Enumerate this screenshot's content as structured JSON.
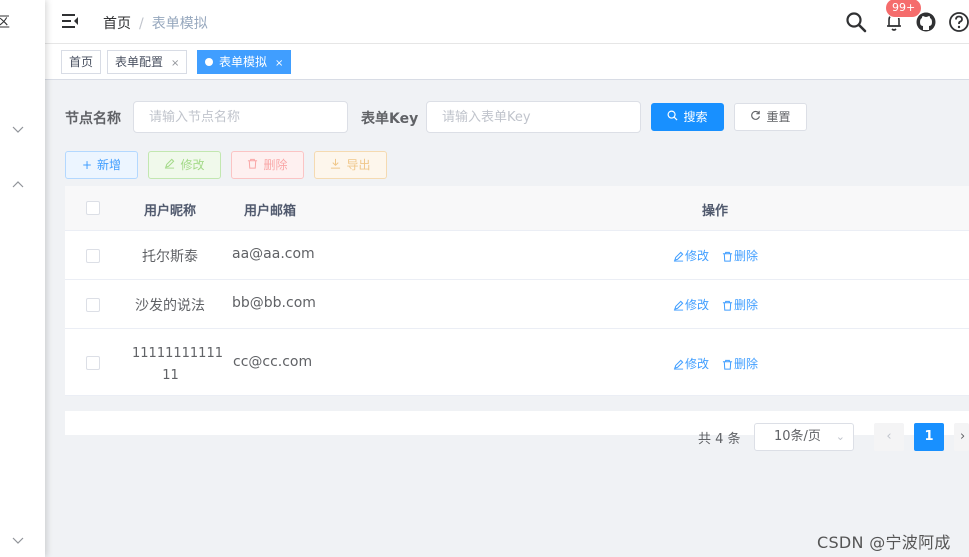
{
  "sidebar": {
    "cut_text": "区"
  },
  "header": {
    "breadcrumb": {
      "home": "首页",
      "separator": "/",
      "current": "表单模拟"
    },
    "notification_badge": "99+"
  },
  "tags": [
    {
      "label": "首页",
      "closable": false,
      "active": false
    },
    {
      "label": "表单配置",
      "closable": true,
      "active": false
    },
    {
      "label": "表单模拟",
      "closable": true,
      "active": true
    }
  ],
  "search": {
    "node_name_label": "节点名称",
    "node_name_placeholder": "请输入节点名称",
    "form_key_label": "表单Key",
    "form_key_placeholder": "请输入表单Key",
    "search_button": "搜索",
    "reset_button": "重置"
  },
  "toolbar": {
    "add": "新增",
    "edit": "修改",
    "delete": "删除",
    "export": "导出"
  },
  "table": {
    "columns": {
      "nickname": "用户昵称",
      "email": "用户邮箱",
      "actions": "操作"
    },
    "rows": [
      {
        "nickname": "托尔斯泰",
        "email": "aa@aa.com",
        "edit": "修改",
        "delete": "删除"
      },
      {
        "nickname": "沙发的说法",
        "email": "bb@bb.com",
        "edit": "修改",
        "delete": "删除"
      },
      {
        "nickname": "1111111111111",
        "nickname_line1": "11111111111",
        "nickname_line2": "11",
        "email": "cc@cc.com",
        "edit": "修改",
        "delete": "删除"
      }
    ]
  },
  "pagination": {
    "total": "共 4 条",
    "page_size": "10条/页",
    "current_page": "1"
  },
  "watermark": "CSDN @宁波阿成",
  "colors": {
    "primary": "#1890ff",
    "active_tag": "#409eff",
    "badge": "#f56c6c"
  }
}
